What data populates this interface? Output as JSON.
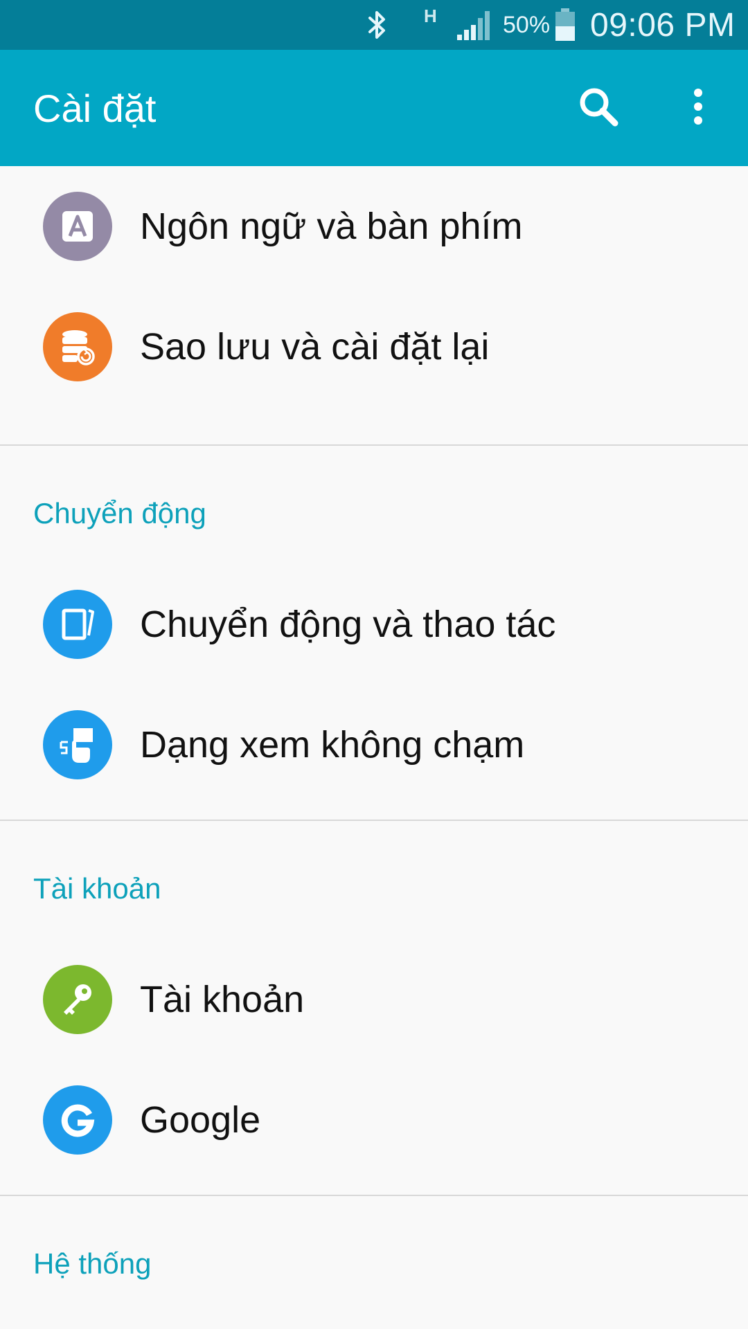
{
  "status_bar": {
    "bluetooth_icon": "bluetooth-icon",
    "network_type": "H",
    "signal_icon": "signal-icon",
    "battery_percent": "50%",
    "battery_level": 0.5,
    "time": "09:06 PM"
  },
  "app_bar": {
    "title": "Cài đặt",
    "search_icon": "search-icon",
    "more_icon": "more-vert-icon"
  },
  "sections": [
    {
      "header": "",
      "items": [
        {
          "label": "Ngôn ngữ và bàn phím",
          "icon": "language-keyboard-icon",
          "color": "#948aa6"
        },
        {
          "label": "Sao lưu và cài đặt lại",
          "icon": "backup-reset-icon",
          "color": "#f07c2a"
        }
      ]
    },
    {
      "header": "Chuyển động",
      "items": [
        {
          "label": "Chuyển động và thao tác",
          "icon": "motion-gesture-icon",
          "color": "#1f9ceb"
        },
        {
          "label": "Dạng xem không chạm",
          "icon": "air-view-icon",
          "color": "#1f9ceb"
        }
      ]
    },
    {
      "header": "Tài khoản",
      "items": [
        {
          "label": "Tài khoản",
          "icon": "account-key-icon",
          "color": "#7cb82e"
        },
        {
          "label": "Google",
          "icon": "google-icon",
          "color": "#1f9ceb"
        }
      ]
    },
    {
      "header": "Hệ thống",
      "items": []
    }
  ],
  "colors": {
    "status_bar": "#047e98",
    "app_bar": "#02a7c5",
    "section_header": "#0da1ba",
    "background": "#f9f9f9"
  }
}
